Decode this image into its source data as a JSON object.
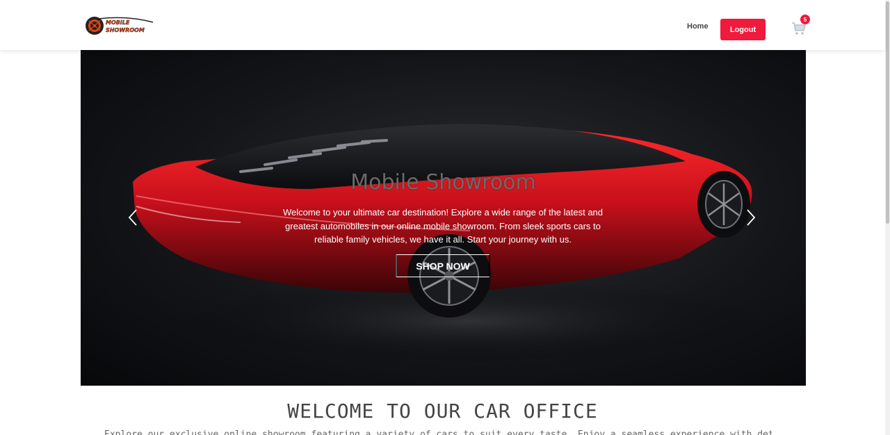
{
  "header": {
    "logo_text": [
      "MOBILE",
      "SHOWROOM"
    ],
    "nav": {
      "home_label": "Home"
    },
    "logout_label": "Logout",
    "cart_count": "5"
  },
  "hero": {
    "title": "Mobile Showroom",
    "description": "Welcome to your ultimate car destination! Explore a wide range of the latest and greatest automobiles in our online mobile showroom. From sleek sports cars to reliable family vehicles, we have it all. Start your journey with us.",
    "cta_label": "SHOP NOW",
    "prev_icon": "chevron-left-icon",
    "next_icon": "chevron-right-icon"
  },
  "welcome": {
    "title": "WELCOME TO OUR CAR OFFICE",
    "text": "Explore our exclusive online showroom featuring a variety of cars to suit every taste. Enjoy a seamless experience with detailed"
  },
  "colors": {
    "accent": "#ef1a3c",
    "logo_orange": "#e8410f",
    "car_red": "#c8101c"
  }
}
